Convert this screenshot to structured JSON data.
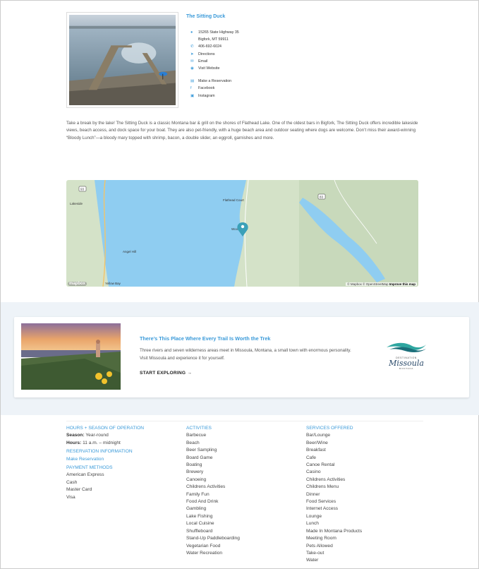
{
  "listing": {
    "title": "The Sitting Duck",
    "address_line1": "15265 State Highway 35",
    "address_line2": "Bigfork, MT 59911",
    "phone": "406-692-6024",
    "directions": "Directions",
    "email": "Email",
    "website": "Visit Website",
    "reservation": "Make a Reservation",
    "facebook": "Facebook",
    "instagram": "Instagram",
    "description": "Take a break by the lake! The Sitting Duck is a classic Montana bar & grill on the shores of Flathead Lake. One of the oldest bars in Bigfork, The Sitting Duck offers incredible lakeside views, beach access, and dock space for your boat. They are also pet-friendly, with a huge beach area and outdoor seating where dogs are welcome. Don’t miss their award-winning “Bloody Lunch”—a bloody mary topped with shrimp, bacon, a double slider, an eggroll, garnishes and more."
  },
  "map": {
    "labels": {
      "lakeside": "Lakeside",
      "woods_bay": "Woods Bay",
      "yellow_bay": "Yellow Bay",
      "flathead_court": "Flathead Court",
      "angel_hill": "Angel Hill",
      "hwy93": "93",
      "hwy83": "83"
    },
    "logo": "mapbox",
    "attribution": "© Mapbox © OpenStreetMap",
    "improve": "Improve this map"
  },
  "promo": {
    "title": "There’s This Place Where Every Trail Is Worth the Trek",
    "text": "Three rivers and seven wilderness areas meet in Missoula, Montana, a small town with enormous personality. Visit Missoula and experience it for yourself.",
    "cta": "START EXPLORING",
    "logo_top": "DESTINATION",
    "logo_name": "Missoula",
    "logo_bottom": "MONTANA"
  },
  "footer": {
    "hours_heading": "HOURS + SEASON OF OPERATION",
    "season_label": "Season:",
    "season_value": "Year-round",
    "hours_label": "Hours:",
    "hours_value": "11 a.m. – midnight",
    "reservation_heading": "RESERVATION INFORMATION",
    "reservation_link": "Make Reservation",
    "payment_heading": "PAYMENT METHODS",
    "payments": [
      "American Express",
      "Cash",
      "Master Card",
      "Visa"
    ],
    "activities_heading": "ACTIVITIES",
    "activities": [
      "Barbecue",
      "Beach",
      "Beer Sampling",
      "Board Game",
      "Boating",
      "Brewery",
      "Canoeing",
      "Childrens Activities",
      "Family Fun",
      "Food And Drink",
      "Gambling",
      "Lake Fishing",
      "Local Cuisine",
      "Shuffleboard",
      "Stand-Up Paddleboarding",
      "Vegetarian Food",
      "Water Recreation"
    ],
    "services_heading": "SERVICES OFFERED",
    "services": [
      "Bar/Lounge",
      "Beer/Wine",
      "Breakfast",
      "Cafe",
      "Canoe Rental",
      "Casino",
      "Childrens Activities",
      "Childrens Menu",
      "Dinner",
      "Food Services",
      "Internet Access",
      "Lounge",
      "Lunch",
      "Made In Montana Products",
      "Meeting Room",
      "Pets Allowed",
      "Take-out",
      "Water"
    ]
  },
  "colors": {
    "accent": "#3a9ad9",
    "water": "#8fcdf1",
    "land": "#d8e4cf",
    "band": "#eef3f8"
  },
  "icons": [
    "location-pin-icon",
    "phone-icon",
    "directions-arrow-icon",
    "email-icon",
    "globe-icon",
    "calendar-icon",
    "facebook-icon",
    "instagram-icon",
    "arrow-right-icon",
    "map-marker-icon"
  ]
}
